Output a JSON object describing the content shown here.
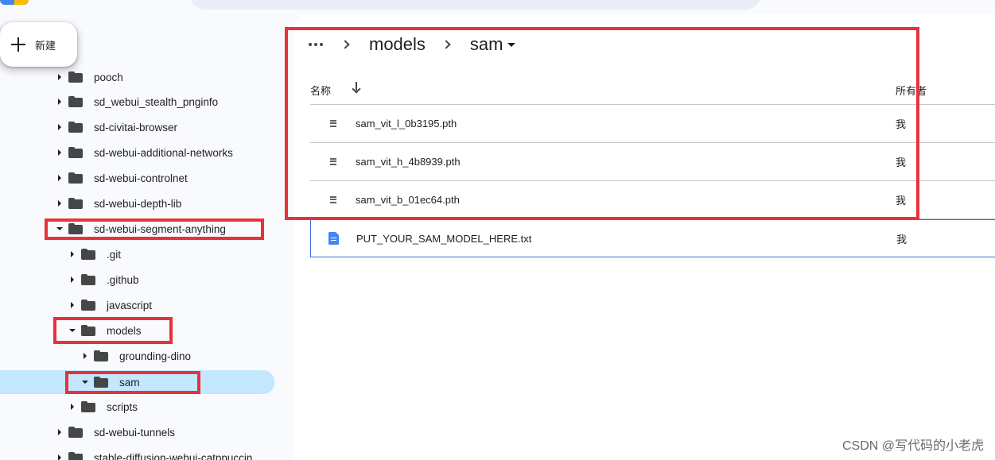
{
  "app": {
    "accent": "#4285f4",
    "highlight": "#c2e7ff",
    "annotation_color": "#e8313a"
  },
  "new_button": {
    "label": "新建",
    "icon": "plus-icon"
  },
  "tree": {
    "items": [
      {
        "label": "pooch",
        "expanded": false
      },
      {
        "label": "sd_webui_stealth_pnginfo",
        "expanded": false
      },
      {
        "label": "sd-civitai-browser",
        "expanded": false
      },
      {
        "label": "sd-webui-additional-networks",
        "expanded": false
      },
      {
        "label": "sd-webui-controlnet",
        "expanded": false
      },
      {
        "label": "sd-webui-depth-lib",
        "expanded": false
      },
      {
        "label": "sd-webui-segment-anything",
        "expanded": true
      },
      {
        "label": ".git",
        "expanded": false
      },
      {
        "label": ".github",
        "expanded": false
      },
      {
        "label": "javascript",
        "expanded": false
      },
      {
        "label": "models",
        "expanded": true
      },
      {
        "label": "grounding-dino",
        "expanded": false
      },
      {
        "label": "sam",
        "expanded": true,
        "selected": true
      },
      {
        "label": "scripts",
        "expanded": false
      },
      {
        "label": "sd-webui-tunnels",
        "expanded": false
      },
      {
        "label": "stable-diffusion-webui-catppuccin",
        "expanded": false
      }
    ]
  },
  "breadcrumb": {
    "more_icon": "more-horiz-icon",
    "items": [
      "models",
      "sam"
    ]
  },
  "table": {
    "headers": {
      "name": "名称",
      "owner": "所有者"
    },
    "sort_icon": "arrow-down-icon",
    "rows": [
      {
        "name": "sam_vit_l_0b3195.pth",
        "owner": "我",
        "icon": "generic-file-icon"
      },
      {
        "name": "sam_vit_h_4b8939.pth",
        "owner": "我",
        "icon": "generic-file-icon"
      },
      {
        "name": "sam_vit_b_01ec64.pth",
        "owner": "我",
        "icon": "generic-file-icon"
      },
      {
        "name": "PUT_YOUR_SAM_MODEL_HERE.txt",
        "owner": "我",
        "icon": "doc-icon"
      }
    ]
  },
  "watermark": "CSDN @写代码的小老虎"
}
